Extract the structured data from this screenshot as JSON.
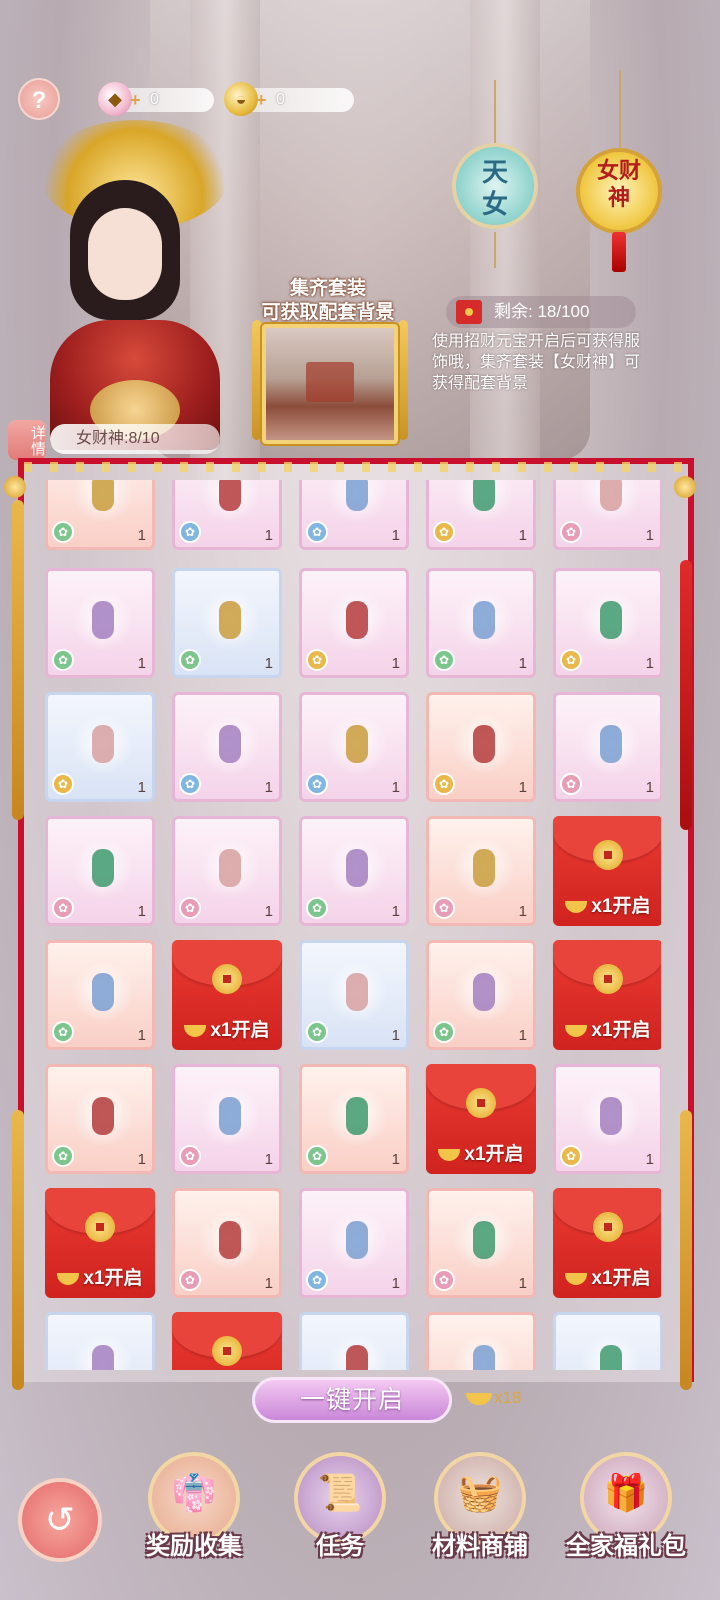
{
  "currencies": [
    {
      "icon": "pink-gem-icon",
      "value": "0"
    },
    {
      "icon": "gold-ingot-icon",
      "value": "0"
    }
  ],
  "character": {
    "detail_label": "详情",
    "progress_text": "女财神:8/10"
  },
  "set_preview": {
    "title_line1": "集齐套装",
    "title_line2": "可获取配套背景"
  },
  "medallions": [
    {
      "text_line1": "天",
      "text_line2": "女"
    },
    {
      "text_line1": "女财",
      "text_line2": "神"
    }
  ],
  "remaining": {
    "label": "剩余: 18/100"
  },
  "description": "使用招财元宝开启后可获得服饰哦，集齐套装【女财神】可获得配套背景",
  "grid": {
    "open_label": "x1开启",
    "rows": [
      [
        {
          "t": "item",
          "q": "1",
          "b": "green",
          "c": "pink"
        },
        {
          "t": "item",
          "q": "1",
          "b": "blue",
          "c": "purple"
        },
        {
          "t": "item",
          "q": "1",
          "b": "blue",
          "c": "purple"
        },
        {
          "t": "item",
          "q": "1",
          "b": "gold",
          "c": "purple"
        },
        {
          "t": "item",
          "q": "1",
          "b": "pink",
          "c": "purple"
        }
      ],
      [
        {
          "t": "item",
          "q": "1",
          "b": "green",
          "c": "purple"
        },
        {
          "t": "item",
          "q": "1",
          "b": "green",
          "c": "blue"
        },
        {
          "t": "item",
          "q": "1",
          "b": "gold",
          "c": "purple"
        },
        {
          "t": "item",
          "q": "1",
          "b": "green",
          "c": "purple"
        },
        {
          "t": "item",
          "q": "1",
          "b": "gold",
          "c": "purple"
        }
      ],
      [
        {
          "t": "item",
          "q": "1",
          "b": "gold",
          "c": "blue"
        },
        {
          "t": "item",
          "q": "1",
          "b": "blue",
          "c": "purple"
        },
        {
          "t": "item",
          "q": "1",
          "b": "blue",
          "c": "purple"
        },
        {
          "t": "item",
          "q": "1",
          "b": "gold",
          "c": "pink"
        },
        {
          "t": "item",
          "q": "1",
          "b": "pink",
          "c": "purple"
        }
      ],
      [
        {
          "t": "item",
          "q": "1",
          "b": "pink",
          "c": "purple"
        },
        {
          "t": "item",
          "q": "1",
          "b": "pink",
          "c": "purple"
        },
        {
          "t": "item",
          "q": "1",
          "b": "green",
          "c": "purple"
        },
        {
          "t": "item",
          "q": "1",
          "b": "pink",
          "c": "pink"
        },
        {
          "t": "red"
        }
      ],
      [
        {
          "t": "item",
          "q": "1",
          "b": "green",
          "c": "pink"
        },
        {
          "t": "red"
        },
        {
          "t": "item",
          "q": "1",
          "b": "green",
          "c": "blue"
        },
        {
          "t": "item",
          "q": "1",
          "b": "green",
          "c": "pink"
        },
        {
          "t": "red"
        }
      ],
      [
        {
          "t": "item",
          "q": "1",
          "b": "green",
          "c": "pink"
        },
        {
          "t": "item",
          "q": "1",
          "b": "pink",
          "c": "purple"
        },
        {
          "t": "item",
          "q": "1",
          "b": "green",
          "c": "pink"
        },
        {
          "t": "red"
        },
        {
          "t": "item",
          "q": "1",
          "b": "gold",
          "c": "purple"
        }
      ],
      [
        {
          "t": "red"
        },
        {
          "t": "item",
          "q": "1",
          "b": "pink",
          "c": "pink"
        },
        {
          "t": "item",
          "q": "1",
          "b": "blue",
          "c": "purple"
        },
        {
          "t": "item",
          "q": "1",
          "b": "pink",
          "c": "pink"
        },
        {
          "t": "red"
        }
      ],
      [
        {
          "t": "item",
          "q": "",
          "b": "blue",
          "c": "blue"
        },
        {
          "t": "red-partial"
        },
        {
          "t": "item",
          "q": "",
          "b": "blue",
          "c": "blue"
        },
        {
          "t": "item",
          "q": "",
          "b": "pink",
          "c": "pink"
        },
        {
          "t": "item",
          "q": "",
          "b": "blue",
          "c": "blue"
        }
      ]
    ]
  },
  "one_key": {
    "label": "一键开启",
    "cost": "x18"
  },
  "bottom_nav": [
    {
      "label": "奖励收集",
      "icon": "robe-icon"
    },
    {
      "label": "任务",
      "icon": "scroll-icon"
    },
    {
      "label": "材料商铺",
      "icon": "basket-icon"
    },
    {
      "label": "全家福礼包",
      "icon": "gift-box-icon"
    }
  ],
  "colors": {
    "accent_red": "#c8102e",
    "gold": "#e8b94a",
    "button_purple": "#c987d8"
  }
}
